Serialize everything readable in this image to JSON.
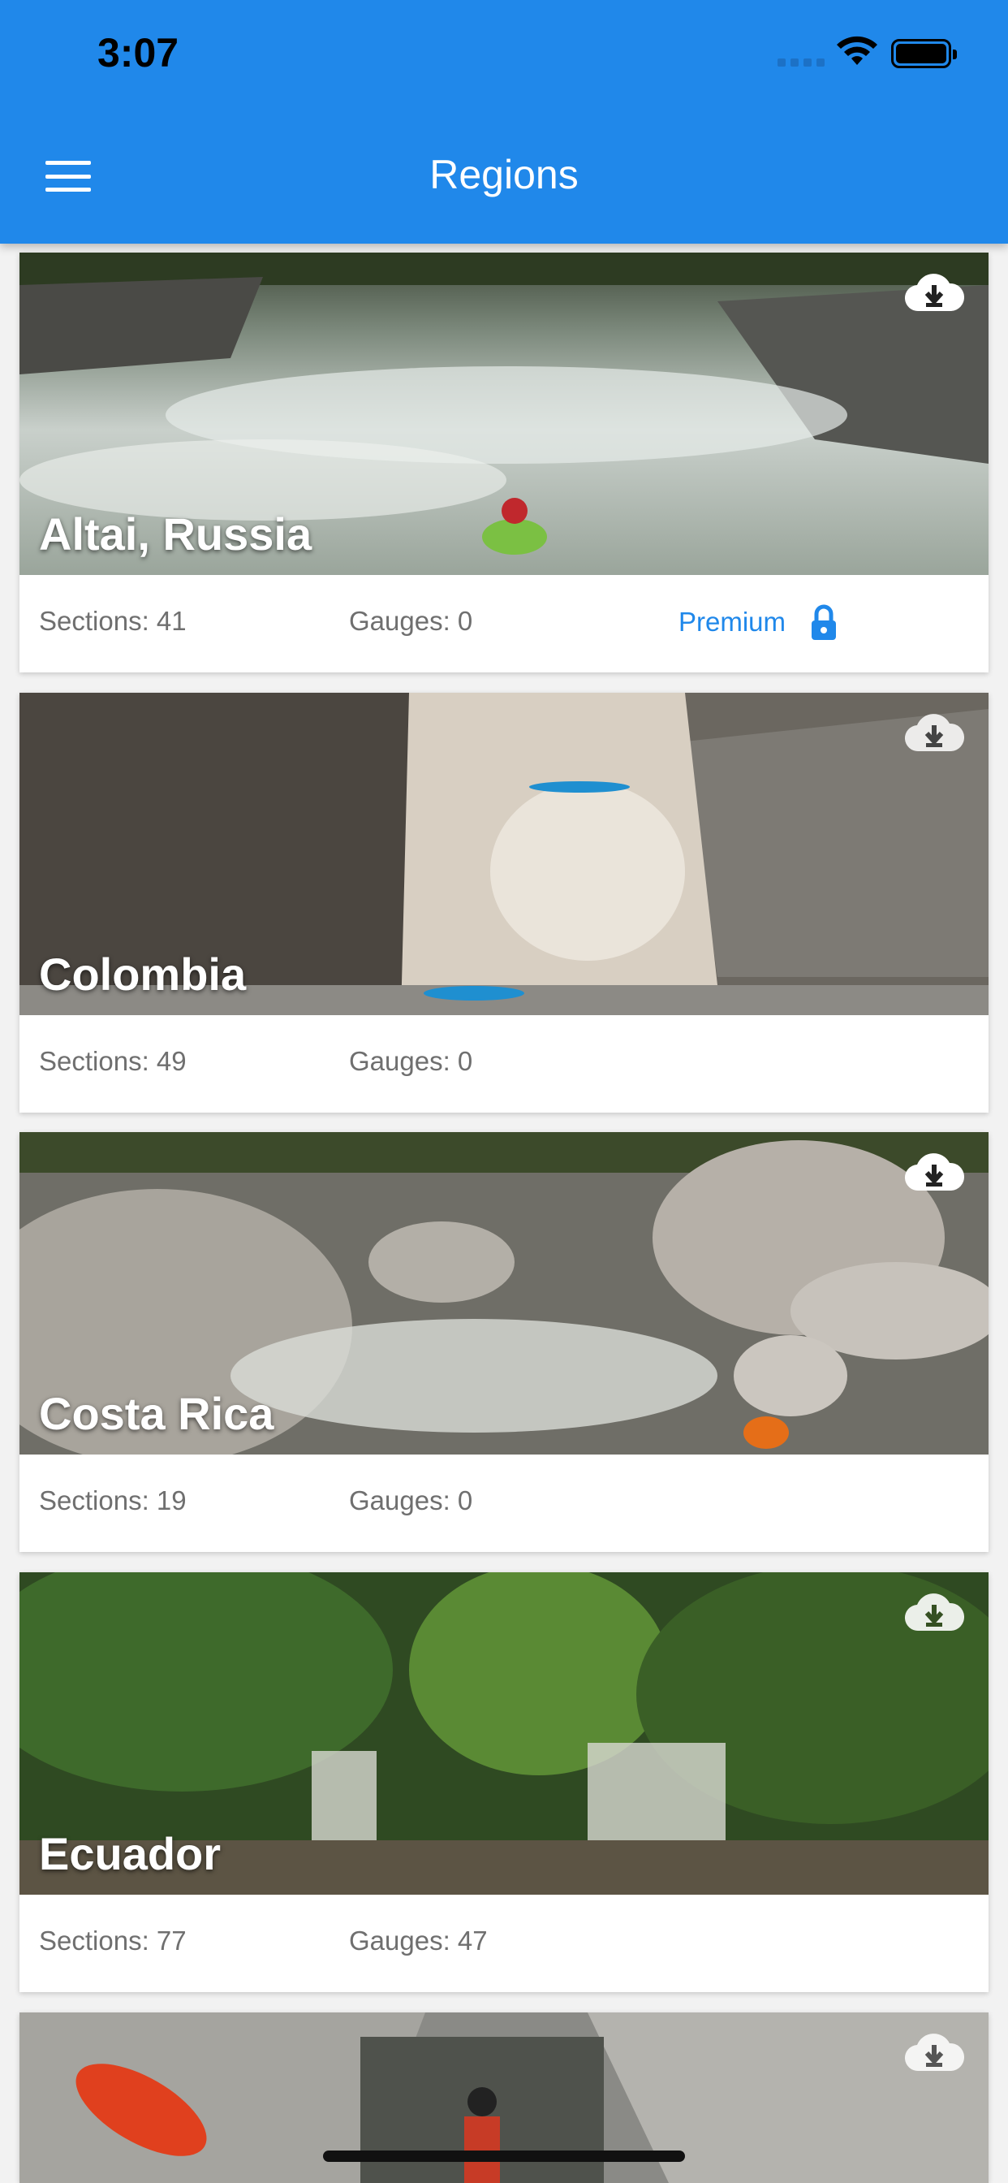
{
  "status_bar": {
    "time": "3:07"
  },
  "header": {
    "title": "Regions"
  },
  "regions": [
    {
      "name": "Altai, Russia",
      "sections": "Sections: 41",
      "gauges": "Gauges: 0",
      "premium": "Premium"
    },
    {
      "name": "Colombia",
      "sections": "Sections: 49",
      "gauges": "Gauges: 0"
    },
    {
      "name": "Costa Rica",
      "sections": "Sections: 19",
      "gauges": "Gauges: 0"
    },
    {
      "name": "Ecuador",
      "sections": "Sections: 77",
      "gauges": "Gauges: 47"
    }
  ],
  "colors": {
    "accent": "#2088ea"
  },
  "icons": [
    "menu-icon",
    "download-cloud-icon",
    "lock-icon",
    "wifi-icon",
    "battery-icon"
  ]
}
